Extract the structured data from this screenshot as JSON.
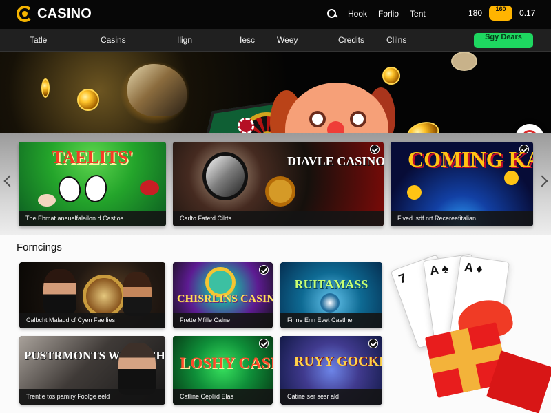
{
  "brand": {
    "name": "CASINO"
  },
  "top_links": [
    "Hook",
    "Forlio",
    "Tent"
  ],
  "counter": {
    "left": "180",
    "pill": "160",
    "right": "0.17"
  },
  "nav": {
    "items": [
      "Tatle",
      "Casins",
      "Ilign",
      "Iesc",
      "Weey",
      "Credits",
      "Clilns"
    ],
    "signup": "Sgy Dears"
  },
  "hero": {
    "badge": "red-ring-icon"
  },
  "featured": [
    {
      "title": "TAELITS'",
      "caption": "The Ebmat aneuelfalailon d Castlos"
    },
    {
      "title": "DIAVLE CASINOS",
      "caption": "Carlto Fatetd Cilrts"
    },
    {
      "title": "COMING KAR",
      "caption": "Fived lsdf nrt Recereefitalian"
    }
  ],
  "section": {
    "title": "Forncings"
  },
  "grid_cards": [
    {
      "title": "",
      "caption": "Calbcht Maladd cf Cyen Faellies"
    },
    {
      "title": "CHISRLINS CASINO",
      "caption": "Frette Mfille Calne"
    },
    {
      "title": "RUITAMASS",
      "caption": "Finne Enn Evet Castlne"
    },
    {
      "title": "PUSTRMONTS WEEK CHEAL COSSINES",
      "caption": "Trentle tos pamiry Foolge eeld"
    },
    {
      "title": "LOSHY CASINS",
      "caption": "Catline Cepliid Elas"
    },
    {
      "title": "RUYY GOCKES",
      "caption": "Catine ser sesr ald"
    }
  ],
  "colors": {
    "accent": "#ffb400",
    "signup": "#1ed760",
    "topbar": "#070707",
    "nav": "#202020"
  },
  "icons": [
    "search-icon",
    "check-icon",
    "chevron-left-icon",
    "chevron-right-icon",
    "gift-icon"
  ]
}
